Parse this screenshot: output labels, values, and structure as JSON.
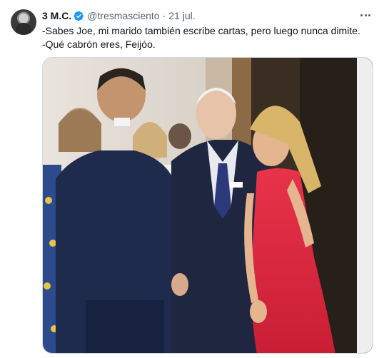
{
  "tweet": {
    "display_name": "3 M.C.",
    "handle": "@tresmasciento",
    "separator": "·",
    "date": "21 jul.",
    "text_lines": [
      "-Sabes Joe, mi marido también escribe cartas, pero luego nunca dimite.",
      "-Qué cabrón eres, Feijóo."
    ]
  },
  "icons": {
    "verified": "verified-badge-icon",
    "more": "more-options-icon"
  },
  "colors": {
    "name": "#0f1419",
    "secondary": "#536471",
    "verified": "#1d9bf0",
    "border": "#cfd9de"
  }
}
